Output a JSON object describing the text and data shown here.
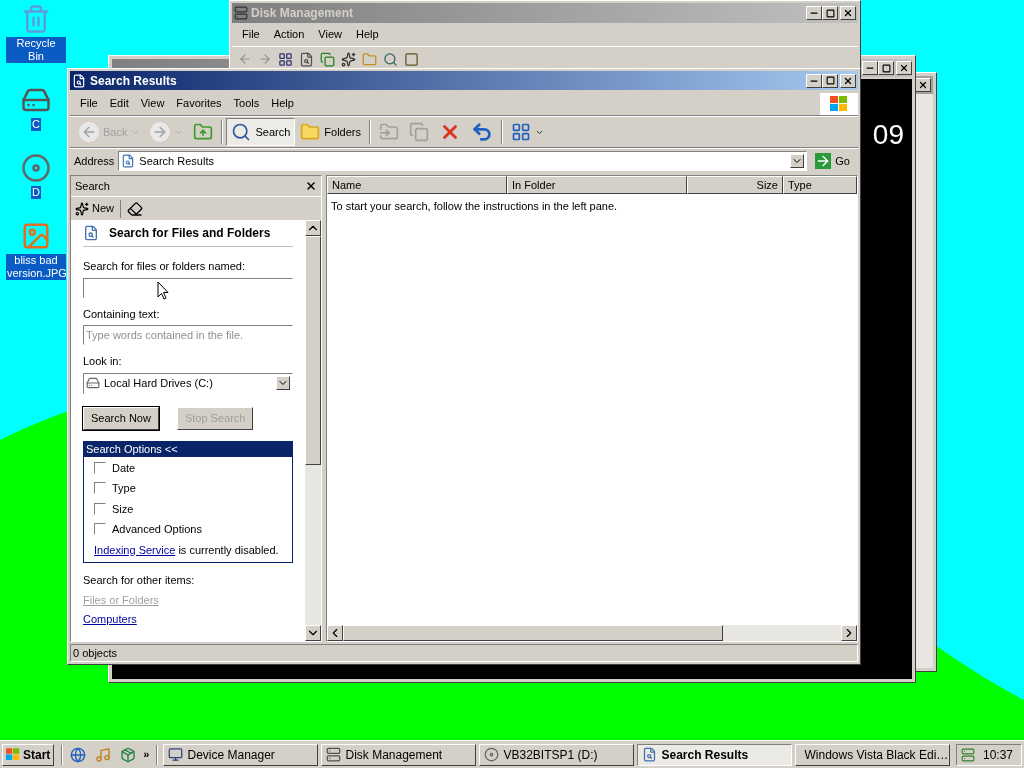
{
  "desktop_icons": [
    {
      "label": "Recycle Bin",
      "kind": "recycle"
    },
    {
      "label": "C",
      "kind": "drive"
    },
    {
      "label": "D",
      "kind": "cd"
    },
    {
      "label": "bliss bad version.JPG",
      "kind": "image"
    }
  ],
  "vista_window": {
    "clock_text": "09"
  },
  "disk_management": {
    "title": "Disk Management",
    "menu": [
      "File",
      "Action",
      "View",
      "Help"
    ]
  },
  "search_window": {
    "title": "Search Results",
    "menu": [
      "File",
      "Edit",
      "View",
      "Favorites",
      "Tools",
      "Help"
    ],
    "toolbar": [
      {
        "kind": "back",
        "label": "Back",
        "disabled": true,
        "selected": false
      },
      {
        "kind": "forward",
        "disabled": true,
        "selected": false
      },
      {
        "kind": "up",
        "disabled": false,
        "selected": false
      },
      {
        "kind": "search",
        "label": "Search",
        "disabled": false,
        "selected": true
      },
      {
        "kind": "folders",
        "label": "Folders",
        "disabled": false,
        "selected": false
      },
      {
        "kind": "move",
        "disabled": true,
        "selected": false
      },
      {
        "kind": "copy",
        "disabled": true,
        "selected": false
      },
      {
        "kind": "delete",
        "disabled": false,
        "selected": false
      },
      {
        "kind": "undo",
        "disabled": false,
        "selected": false
      },
      {
        "kind": "views",
        "disabled": false,
        "selected": false
      }
    ],
    "address": {
      "label": "Address",
      "value": "Search Results",
      "go": "Go"
    },
    "search_pane": {
      "title": "Search",
      "new": "New",
      "heading": "Search for Files and Folders",
      "name_label": "Search for files or folders named:",
      "containing_label": "Containing text:",
      "containing_placeholder": "Type words contained in the file.",
      "lookin_label": "Look in:",
      "lookin_value": "Local Hard Drives (C:)",
      "buttons": [
        {
          "label": "Search Now",
          "disabled": false
        },
        {
          "label": "Stop Search",
          "disabled": true
        }
      ],
      "options": {
        "title": "Search Options <<",
        "items": [
          {
            "label": "Date",
            "checked": false
          },
          {
            "label": "Type",
            "checked": false
          },
          {
            "label": "Size",
            "checked": false
          },
          {
            "label": "Advanced Options",
            "checked": false
          }
        ],
        "note_link": "Indexing Service",
        "note_text": "is currently disabled."
      },
      "other_label": "Search for other items:",
      "other_links": [
        {
          "label": "Files or Folders",
          "disabled": true
        },
        {
          "label": "Computers",
          "disabled": false
        }
      ]
    },
    "results": {
      "columns": [
        {
          "label": "Name"
        },
        {
          "label": "In Folder"
        },
        {
          "label": "Size"
        },
        {
          "label": "Type"
        }
      ],
      "message": "To start your search, follow the instructions in the left pane."
    },
    "status_bar": "0 objects"
  },
  "taskbar": {
    "start": "Start",
    "chevron": "»",
    "tasks": [
      {
        "label": "Device Manager",
        "kind": "device",
        "selected": false
      },
      {
        "label": "Disk Management",
        "kind": "disk",
        "selected": false
      },
      {
        "label": "VB32BITSP1 (D:)",
        "kind": "cd",
        "selected": false
      },
      {
        "label": "Search Results",
        "kind": "search",
        "selected": true
      },
      {
        "label": "Windows Vista Black Edi…",
        "kind": "setup",
        "selected": false
      }
    ],
    "clock": "10:37"
  }
}
